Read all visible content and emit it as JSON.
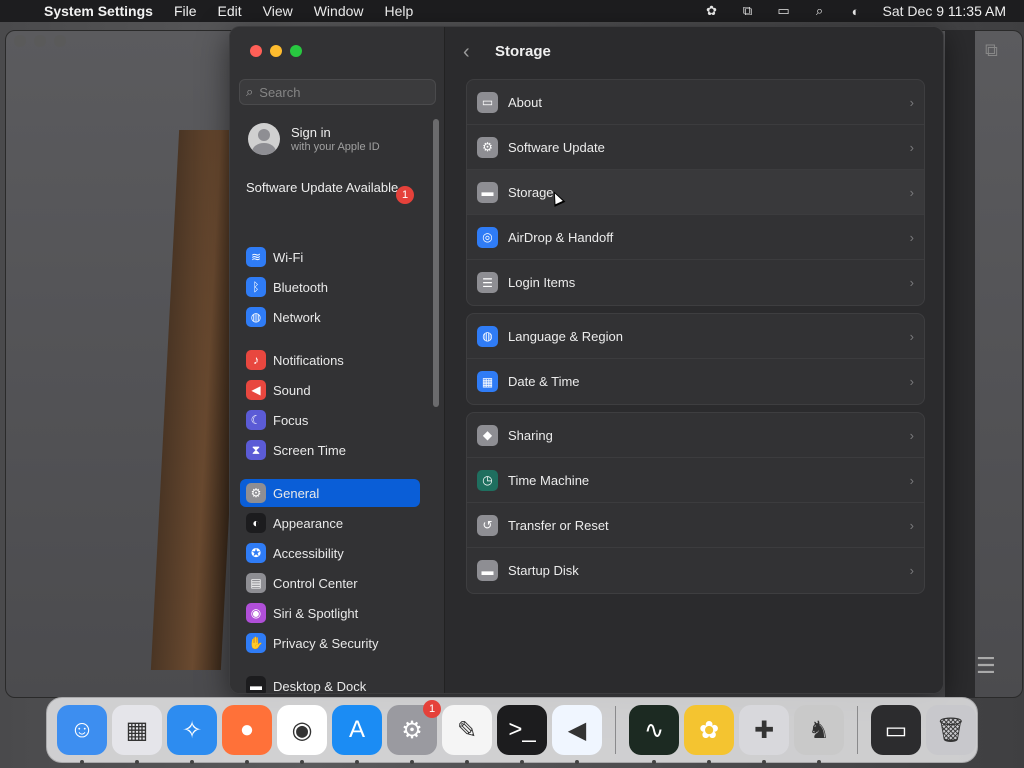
{
  "menubar": {
    "app_name": "System Settings",
    "menus": [
      "File",
      "Edit",
      "View",
      "Window",
      "Help"
    ],
    "clock": "Sat Dec 9  11:35 AM"
  },
  "search": {
    "placeholder": "Search"
  },
  "account": {
    "title": "Sign in",
    "subtitle": "with your Apple ID"
  },
  "update": {
    "label": "Software Update Available",
    "badge": "1"
  },
  "sidebar": {
    "items": [
      {
        "label": "Wi-Fi",
        "icon": "wifi-icon",
        "color": "#2f7cf6"
      },
      {
        "label": "Bluetooth",
        "icon": "bluetooth-icon",
        "color": "#2f7cf6"
      },
      {
        "label": "Network",
        "icon": "globe-icon",
        "color": "#2f7cf6"
      },
      {
        "label": "Notifications",
        "icon": "bell-icon",
        "color": "#e8473f"
      },
      {
        "label": "Sound",
        "icon": "speaker-icon",
        "color": "#e8473f"
      },
      {
        "label": "Focus",
        "icon": "moon-icon",
        "color": "#5b5bd6"
      },
      {
        "label": "Screen Time",
        "icon": "hourglass-icon",
        "color": "#5b5bd6"
      },
      {
        "label": "General",
        "icon": "gear-icon",
        "color": "#8e8e93"
      },
      {
        "label": "Appearance",
        "icon": "appearance-icon",
        "color": "#1c1c1e"
      },
      {
        "label": "Accessibility",
        "icon": "accessibility-icon",
        "color": "#2f7cf6"
      },
      {
        "label": "Control Center",
        "icon": "control-center-icon",
        "color": "#8e8e93"
      },
      {
        "label": "Siri & Spotlight",
        "icon": "siri-icon",
        "color": "#b04fd8"
      },
      {
        "label": "Privacy & Security",
        "icon": "hand-icon",
        "color": "#2f7cf6"
      },
      {
        "label": "Desktop & Dock",
        "icon": "dock-icon",
        "color": "#1c1c1e"
      }
    ],
    "selected": "General"
  },
  "content": {
    "title": "Storage",
    "groups": [
      [
        {
          "label": "About",
          "icon": "laptop-icon",
          "color": "#8e8e93"
        },
        {
          "label": "Software Update",
          "icon": "gear-badge-icon",
          "color": "#8e8e93"
        },
        {
          "label": "Storage",
          "icon": "disk-icon",
          "color": "#8e8e93"
        },
        {
          "label": "AirDrop & Handoff",
          "icon": "airdrop-icon",
          "color": "#2f7cf6"
        },
        {
          "label": "Login Items",
          "icon": "list-icon",
          "color": "#8e8e93"
        }
      ],
      [
        {
          "label": "Language & Region",
          "icon": "globe-icon",
          "color": "#2f7cf6"
        },
        {
          "label": "Date & Time",
          "icon": "calendar-icon",
          "color": "#2f7cf6"
        }
      ],
      [
        {
          "label": "Sharing",
          "icon": "sharing-icon",
          "color": "#8e8e93"
        },
        {
          "label": "Time Machine",
          "icon": "time-machine-icon",
          "color": "#1f6f5f"
        },
        {
          "label": "Transfer or Reset",
          "icon": "reset-icon",
          "color": "#8e8e93"
        },
        {
          "label": "Startup Disk",
          "icon": "disk-icon",
          "color": "#8e8e93"
        }
      ]
    ]
  },
  "dock": {
    "apps": [
      {
        "name": "finder-icon",
        "glyph": "☺",
        "bg": "#3d8ef0"
      },
      {
        "name": "launchpad-icon",
        "glyph": "▦",
        "bg": "#e5e5ea"
      },
      {
        "name": "safari-icon",
        "glyph": "✧",
        "bg": "#2d8cf0"
      },
      {
        "name": "firefox-icon",
        "glyph": "●",
        "bg": "#ff7139"
      },
      {
        "name": "chrome-icon",
        "glyph": "◉",
        "bg": "#ffffff"
      },
      {
        "name": "app-store-icon",
        "glyph": "A",
        "bg": "#1b8cf4"
      },
      {
        "name": "system-settings-icon",
        "glyph": "⚙",
        "bg": "#9a9aa0",
        "badge": "1"
      },
      {
        "name": "textedit-icon",
        "glyph": "✎",
        "bg": "#f5f5f5"
      },
      {
        "name": "terminal-icon",
        "glyph": ">_",
        "bg": "#1c1c1e"
      },
      {
        "name": "vscode-icon",
        "glyph": "◀",
        "bg": "#f0f6ff"
      },
      {
        "name": "activity-monitor-icon",
        "glyph": "∿",
        "bg": "#1c2a22"
      },
      {
        "name": "bee-app-icon",
        "glyph": "✿",
        "bg": "#f4c430"
      },
      {
        "name": "disk-utility-icon",
        "glyph": "✚",
        "bg": "#d8d8dc"
      },
      {
        "name": "chess-icon",
        "glyph": "♞",
        "bg": "#c9c9c9"
      },
      {
        "name": "screen-window-icon",
        "glyph": "▭",
        "bg": "#2c2c2e"
      },
      {
        "name": "trash-icon",
        "glyph": "🗑",
        "bg": "#c8c8cc"
      }
    ]
  }
}
